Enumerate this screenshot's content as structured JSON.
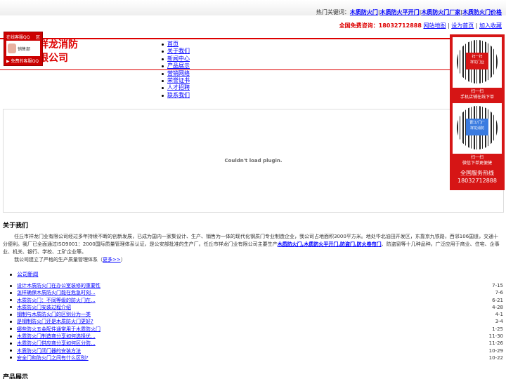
{
  "header": {
    "hot_label": "热门关键词：",
    "hot_keywords": [
      "木质防火门",
      "木质防火平开门",
      "木质防火门厂家",
      "木质防火门价格"
    ],
    "consult_label": "全国免费咨询：",
    "consult_phone": "18032712888",
    "links": [
      "网站地图",
      "设为首页",
      "加入收藏"
    ]
  },
  "logo": {
    "line1": "祥龙消防",
    "line2": "限公司"
  },
  "qq": {
    "title": "在线客服QQ",
    "close": "区",
    "dept": "销售部",
    "footer": "▶ 免费的客服QQ"
  },
  "nav": [
    "首页",
    "关于我们",
    "新闻中心",
    "产品展示",
    "营销网络",
    "荣誉证书",
    "人才招聘",
    "联系我们"
  ],
  "plugin_msg": "Couldn't load plugin.",
  "side": {
    "qr1_center": "扫一扫\n祥龙门业",
    "qr1_caption1": "扫一扫",
    "qr1_caption2": "手机店铺在线下单",
    "qr2_center": "晋江/门厂\n祥龙消防",
    "qr2_caption1": "扫一扫",
    "qr2_caption2": "微信下单更便捷",
    "hotline_label": "全国服务热线",
    "hotline_phone": "18032712888"
  },
  "about": {
    "heading": "关于我们",
    "text": "任丘市祥龙门业有限公司经过多年持续不断的创新发展，已成为国内一家集设计、生产、销售为一体的现代化钢质门专业制造企业，我公司占地面积3000平方米。地处华北油田开发区，东靠京九铁路，西邻106国道，交通十分便利。我厂已全面通过ISO9001：2000国际质量管理体系认证，是公安部批准的生产厂。任丘市祥龙门业有限公司主要生产",
    "products_link": "木质防火门,木质防火平开门,防盗门,防火卷帘门",
    "text_tail": "、防盗窗等十几种品种。广泛应用于商业、住宅、企事业、机关、银行、学校、工矿企业等。",
    "line2": "我公司建立了严格的生产质量管理体系（",
    "more": "更多>>",
    "line2_end": "）"
  },
  "news": {
    "heading": "公司新闻",
    "items": [
      {
        "title": "设计木质防火门在办公室装修的重要性",
        "date": "7-15"
      },
      {
        "title": "怎样确保木质防火门能在危急时刻...",
        "date": "7-6"
      },
      {
        "title": "木质防火门：不同等级的防火门在...",
        "date": "6-21"
      },
      {
        "title": "木质防火门安装过程介绍",
        "date": "4-28"
      },
      {
        "title": "钢制与木质防火门的区别分为一类",
        "date": "4-1"
      },
      {
        "title": "是钢制防火门还是木质防火门更好?",
        "date": "3-4"
      },
      {
        "title": "哪些防火五金配件通常用于木质防火门",
        "date": "1-25"
      },
      {
        "title": "木质防火门制造商分享如何选择优...",
        "date": "11-30"
      },
      {
        "title": "木质防火门供应商分享如何区分防...",
        "date": "11-26"
      },
      {
        "title": "木质防火门闭门器的安装方法",
        "date": "10-29"
      },
      {
        "title": "安全门和防火门之间有什么区别?",
        "date": "10-22"
      }
    ]
  },
  "products": {
    "heading": "产品展示"
  }
}
